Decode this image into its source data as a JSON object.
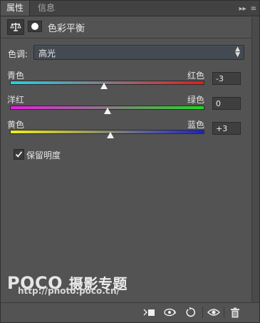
{
  "tabs": [
    {
      "label": "属性"
    },
    {
      "label": "信息"
    }
  ],
  "tab_controls": {
    "collapse": "▸▸",
    "menu": "≡"
  },
  "header": {
    "title": "色彩平衡"
  },
  "tone": {
    "label": "色调:",
    "value": "高光"
  },
  "sliders": [
    {
      "left": "青色",
      "right": "红色",
      "value": "-3",
      "fraction": 0.485,
      "gradient_from": "#22d3e6",
      "gradient_to": "#e21c1c"
    },
    {
      "left": "洋红",
      "right": "绿色",
      "value": "0",
      "fraction": 0.5,
      "gradient_from": "#e81fe0",
      "gradient_to": "#23d823"
    },
    {
      "left": "黄色",
      "right": "蓝色",
      "value": "+3",
      "fraction": 0.515,
      "gradient_from": "#f0ee1c",
      "gradient_to": "#1c22c8"
    }
  ],
  "preserve_luminosity": {
    "label": "保留明度",
    "checked": true
  },
  "watermark": {
    "brand": "POCO",
    "sub": "摄影专题",
    "url": "http://photo.poco.cn/"
  },
  "bottom_icons": [
    "clip-to-layer-icon",
    "view-previous-icon",
    "reset-icon",
    "visibility-eye-icon",
    "trash-icon"
  ]
}
